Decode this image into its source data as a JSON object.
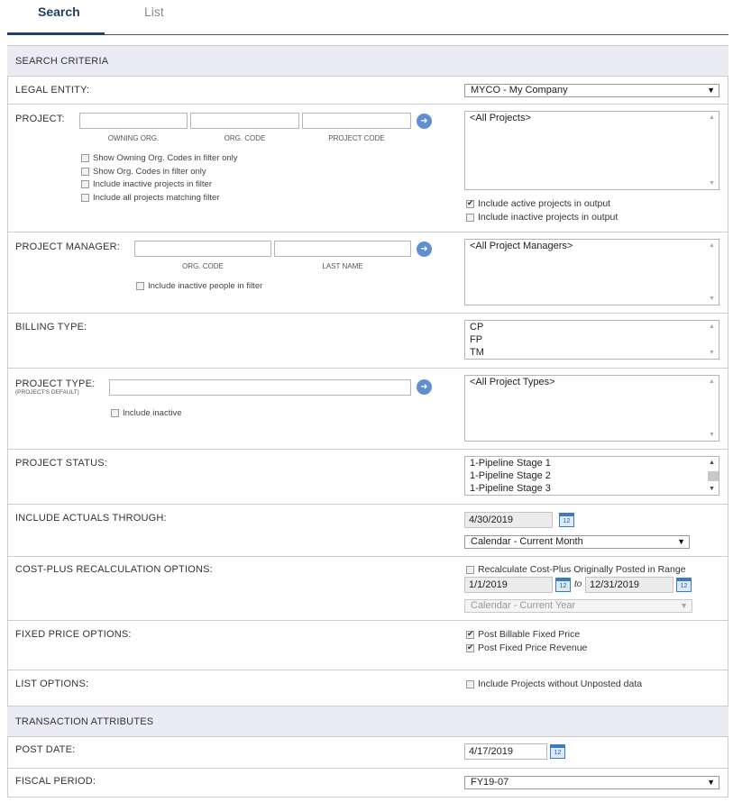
{
  "tabs": {
    "search": "Search",
    "list": "List"
  },
  "search_criteria": "SEARCH CRITERIA",
  "legal_entity": {
    "label": "LEGAL ENTITY:",
    "value": "MYCO - My Company"
  },
  "project": {
    "label": "PROJECT:",
    "sub_owning": "OWNING ORG.",
    "sub_org": "ORG. CODE",
    "sub_code": "PROJECT CODE",
    "opt1": "Show Owning Org. Codes in filter only",
    "opt2": "Show Org. Codes in filter only",
    "opt3": "Include inactive projects in filter",
    "opt4": "Include all projects matching filter",
    "list": [
      "<All Projects>"
    ],
    "out_active": "Include active projects in output",
    "out_inactive": "Include inactive projects in output"
  },
  "pm": {
    "label": "PROJECT MANAGER:",
    "sub_org": "ORG. CODE",
    "sub_last": "LAST NAME",
    "opt": "Include inactive people in filter",
    "list": [
      "<All Project Managers>"
    ]
  },
  "billing": {
    "label": "BILLING TYPE:",
    "list": [
      "CP",
      "FP",
      "TM"
    ]
  },
  "ptype": {
    "label": "PROJECT TYPE:",
    "sub": "(PROJECT'S DEFAULT)",
    "opt": "Include inactive",
    "list": [
      "<All Project Types>"
    ]
  },
  "status": {
    "label": "PROJECT STATUS:",
    "list": [
      "1-Pipeline Stage 1",
      "1-Pipeline Stage 2",
      "1-Pipeline Stage 3"
    ]
  },
  "actuals": {
    "label": "INCLUDE ACTUALS THROUGH:",
    "date": "4/30/2019",
    "range": "Calendar - Current Month"
  },
  "costplus": {
    "label": "COST-PLUS RECALCULATION OPTIONS:",
    "opt": "Recalculate Cost-Plus Originally Posted in Range",
    "from": "1/1/2019",
    "to_label": "to",
    "to": "12/31/2019",
    "range": "Calendar - Current Year"
  },
  "fixed": {
    "label": "FIXED PRICE OPTIONS:",
    "opt1": "Post Billable Fixed Price",
    "opt2": "Post Fixed Price Revenue"
  },
  "listopts": {
    "label": "LIST OPTIONS:",
    "opt": "Include Projects without Unposted data"
  },
  "transaction_attributes": "TRANSACTION ATTRIBUTES",
  "post_date": {
    "label": "POST DATE:",
    "value": "4/17/2019"
  },
  "fiscal": {
    "label": "FISCAL PERIOD:",
    "value": "FY19-07"
  },
  "icons": {
    "go": "arrow-right-circle-icon",
    "calendar": "calendar-icon",
    "dropdown": "chevron-down-icon"
  },
  "colors": {
    "accent": "#1f3f6b",
    "header_bg": "#ebebf5",
    "go_button": "#5f8fd1"
  }
}
